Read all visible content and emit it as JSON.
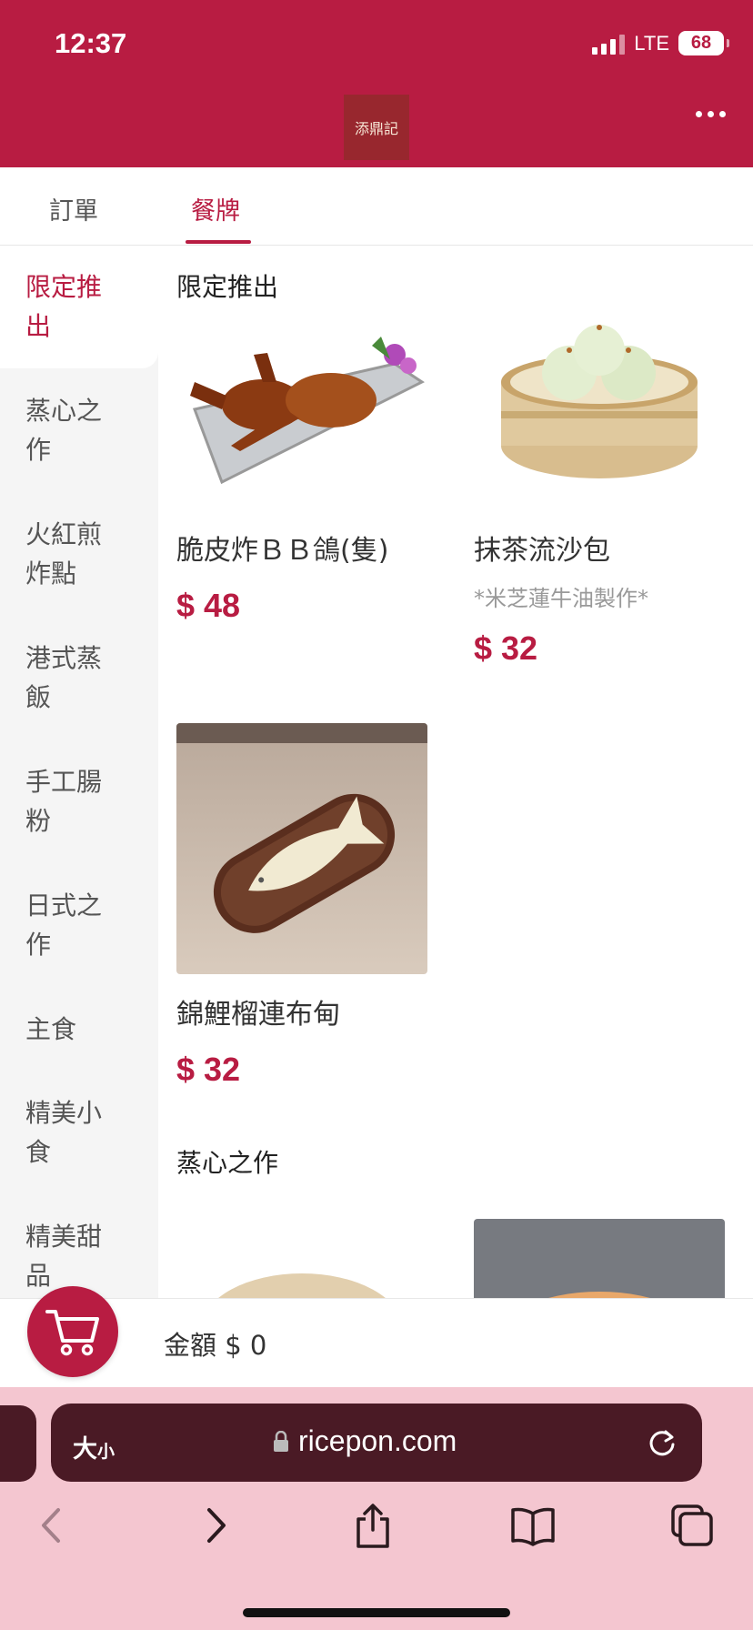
{
  "status": {
    "time": "12:37",
    "network": "LTE",
    "battery": "68"
  },
  "header": {
    "logo_text": "添鼎記"
  },
  "tabs": [
    {
      "label": "訂單"
    },
    {
      "label": "餐牌"
    }
  ],
  "sidebar": {
    "categories": [
      {
        "label": "限定推出"
      },
      {
        "label": "蒸心之作"
      },
      {
        "label": "火紅煎炸點"
      },
      {
        "label": "港式蒸飯"
      },
      {
        "label": "手工腸粉"
      },
      {
        "label": "日式之作"
      },
      {
        "label": "主食"
      },
      {
        "label": "精美小食"
      },
      {
        "label": "精美甜品"
      }
    ]
  },
  "sections": [
    {
      "title": "限定推出",
      "items": [
        {
          "name": "脆皮炸ＢＢ鴿(隻)",
          "note": "",
          "price": "$ 48",
          "icon": "roast-pigeon-image"
        },
        {
          "name": "抹茶流沙包",
          "note": "*米芝蓮牛油製作*",
          "price": "$ 32",
          "icon": "matcha-bun-image"
        },
        {
          "name": "錦鯉榴連布甸",
          "note": "",
          "price": "$ 32",
          "icon": "koi-pudding-image"
        }
      ]
    },
    {
      "title": "蒸心之作",
      "items": []
    }
  ],
  "cart": {
    "amount_label": "金額 $ 0"
  },
  "browser": {
    "text_size_label": "大",
    "text_size_small": "小",
    "url": "ricepon.com"
  },
  "colors": {
    "brand": "#b81c42",
    "browser_bg": "#f4c6d0",
    "urlbar": "#4a1a25"
  }
}
